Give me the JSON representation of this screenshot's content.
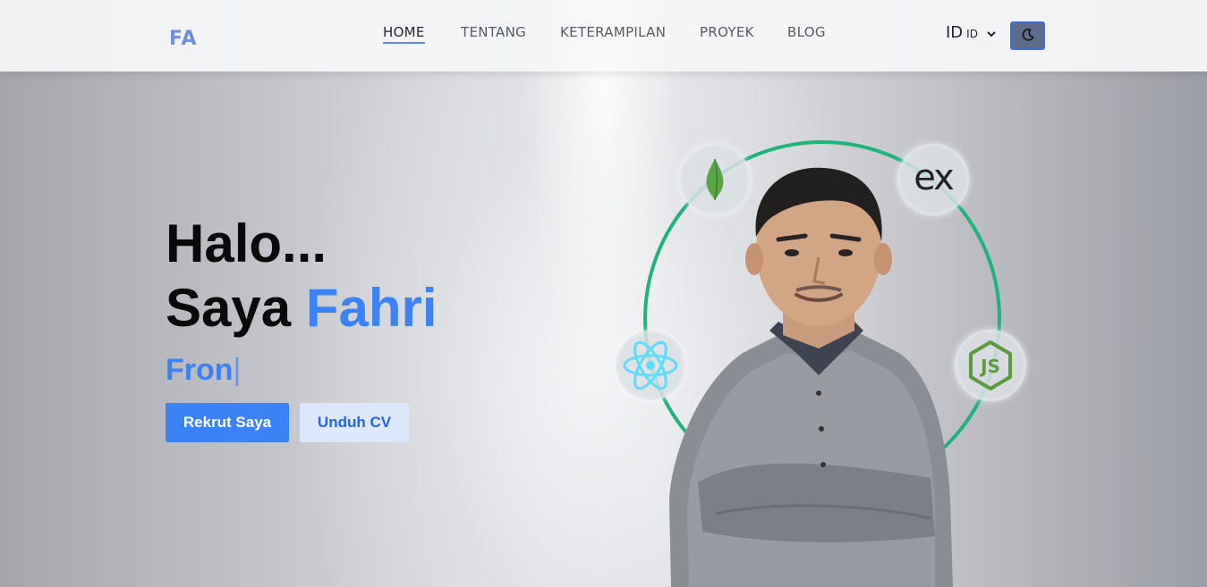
{
  "header": {
    "logo": "FA",
    "nav": [
      {
        "label": "HOME",
        "active": true
      },
      {
        "label": "TENTANG",
        "active": false
      },
      {
        "label": "KETERAMPILAN",
        "active": false
      },
      {
        "label": "PROYEK",
        "active": false
      },
      {
        "label": "BLOG",
        "active": false
      }
    ],
    "language": {
      "code": "ID",
      "flag_text": "ID"
    },
    "theme_icon": "moon-icon"
  },
  "hero": {
    "greeting": "Halo...",
    "intro": "Saya",
    "name": "Fahri",
    "typed_text": "Fron",
    "cursor": "|",
    "hire_button": "Rekrut Saya",
    "cv_button": "Unduh CV"
  },
  "tech_icons": [
    "mongodb-icon",
    "express-icon",
    "react-icon",
    "nodejs-icon"
  ],
  "express_logo_text": "ex",
  "colors": {
    "accent": "#3b82f6",
    "logo": "#6d8fd6",
    "orbit": "#1fb37b",
    "theme_button": "#5d6c8c"
  }
}
